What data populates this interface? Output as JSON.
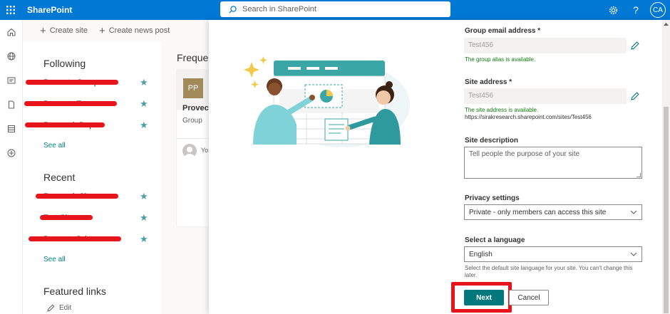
{
  "suitebar": {
    "brand": "SharePoint",
    "search_placeholder": "Search in SharePoint",
    "avatar_initials": "CA"
  },
  "commandbar": {
    "create_site": "Create site",
    "create_news": "Create news post"
  },
  "left": {
    "following_title": "Following",
    "following_items": [
      "Provecta Group",
      "Provecta Team",
      "Research Dept"
    ],
    "see_all": "See all",
    "recent_title": "Recent",
    "recent_items": [
      "Research Site",
      "Test Site",
      "Provecta Drive"
    ],
    "see_all_2": "See all",
    "featured_title": "Featured links",
    "edit": "Edit"
  },
  "middle": {
    "frequent_title": "Frequen",
    "card": {
      "initials": "PP",
      "title": "Provect",
      "subtitle": "Group",
      "activity": "Yo"
    }
  },
  "panel": {
    "group_email_label": "Group email address *",
    "group_email_value": "Test456",
    "group_email_msg": "The group alias is available.",
    "site_address_label": "Site address *",
    "site_address_value": "Test456",
    "site_address_msg": "The site address is available.",
    "site_url": "https://sirakresearch.sharepoint.com/sites/Test456",
    "site_desc_label": "Site description",
    "site_desc_placeholder": "Tell people the purpose of your site",
    "privacy_label": "Privacy settings",
    "privacy_value": "Private - only members can access this site",
    "language_label": "Select a language",
    "language_value": "English",
    "language_hint": "Select the default site language for your site. You can't change this later.",
    "next": "Next",
    "cancel": "Cancel"
  },
  "colors": {
    "suitebar": "#0078d4",
    "accent": "#03787c",
    "redaction": "#e8141b",
    "star": "#4b9ea5"
  }
}
